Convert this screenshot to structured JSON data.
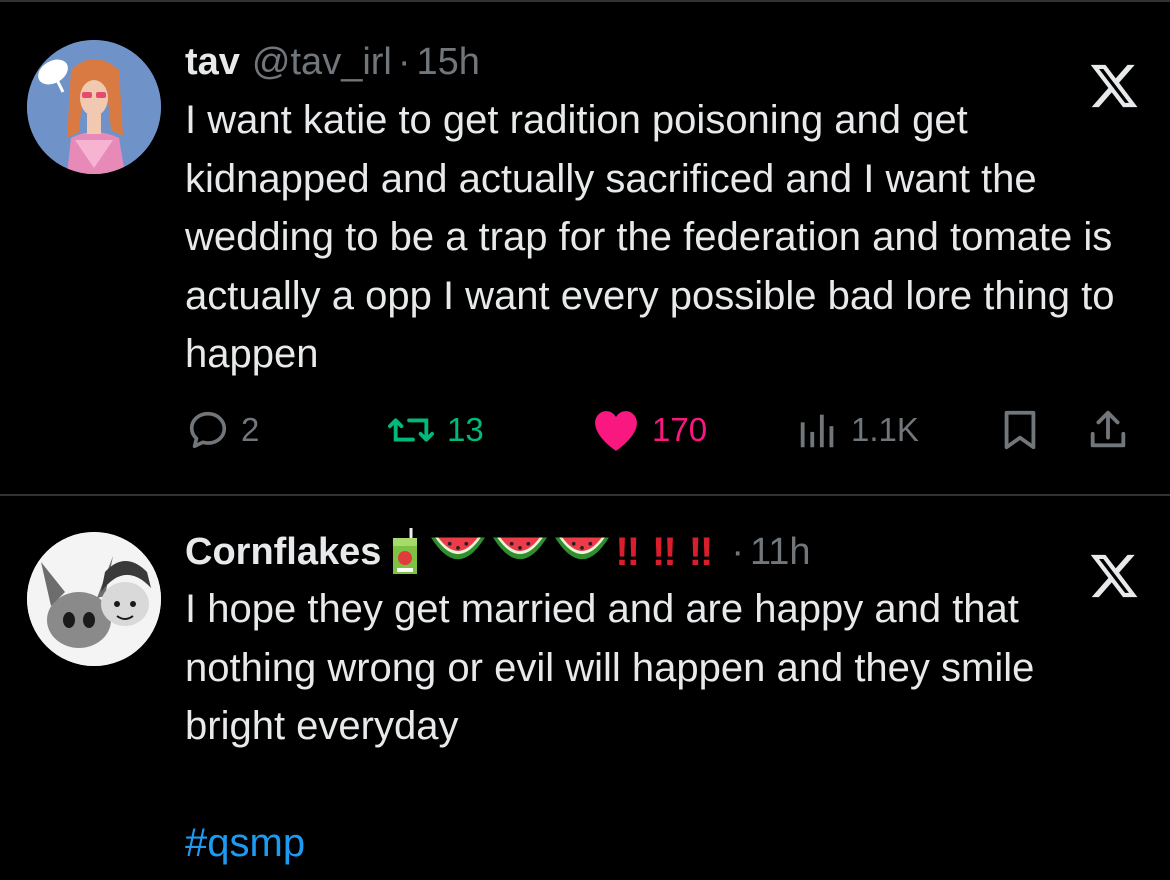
{
  "tweets": [
    {
      "name": "tav",
      "handle": "@tav_irl",
      "separator": "·",
      "time": "15h",
      "body": "I want katie to get radition poisoning and get kidnapped and actually sacrificed and I want the wedding to be a trap for the federation and tomate is actually a opp I want every possible bad lore thing to happen",
      "stats": {
        "replies": "2",
        "reposts": "13",
        "likes": "170",
        "views": "1.1K"
      },
      "liked": true
    },
    {
      "name": "Cornflakes",
      "separator": "·",
      "time": "11h",
      "name_emojis": [
        "juice-box-emoji",
        "watermelon-emoji",
        "watermelon-emoji",
        "watermelon-emoji"
      ],
      "exclamations": [
        "!!",
        "!!",
        "!!"
      ],
      "body": "I hope they get married and are happy and that nothing wrong or evil will happen and they smile bright everyday",
      "hashtag": "#qsmp"
    }
  ],
  "colors": {
    "background": "#000000",
    "text": "#e7e9ea",
    "muted": "#71767b",
    "repost_green": "#00ba7c",
    "like_pink": "#f91880",
    "link_blue": "#1d9bf0",
    "exclamation_red": "#d81e2c",
    "divider": "#2f3336"
  },
  "icons": [
    "x-logo-icon",
    "reply-icon",
    "repost-icon",
    "heart-icon",
    "views-icon",
    "bookmark-icon",
    "share-icon"
  ]
}
